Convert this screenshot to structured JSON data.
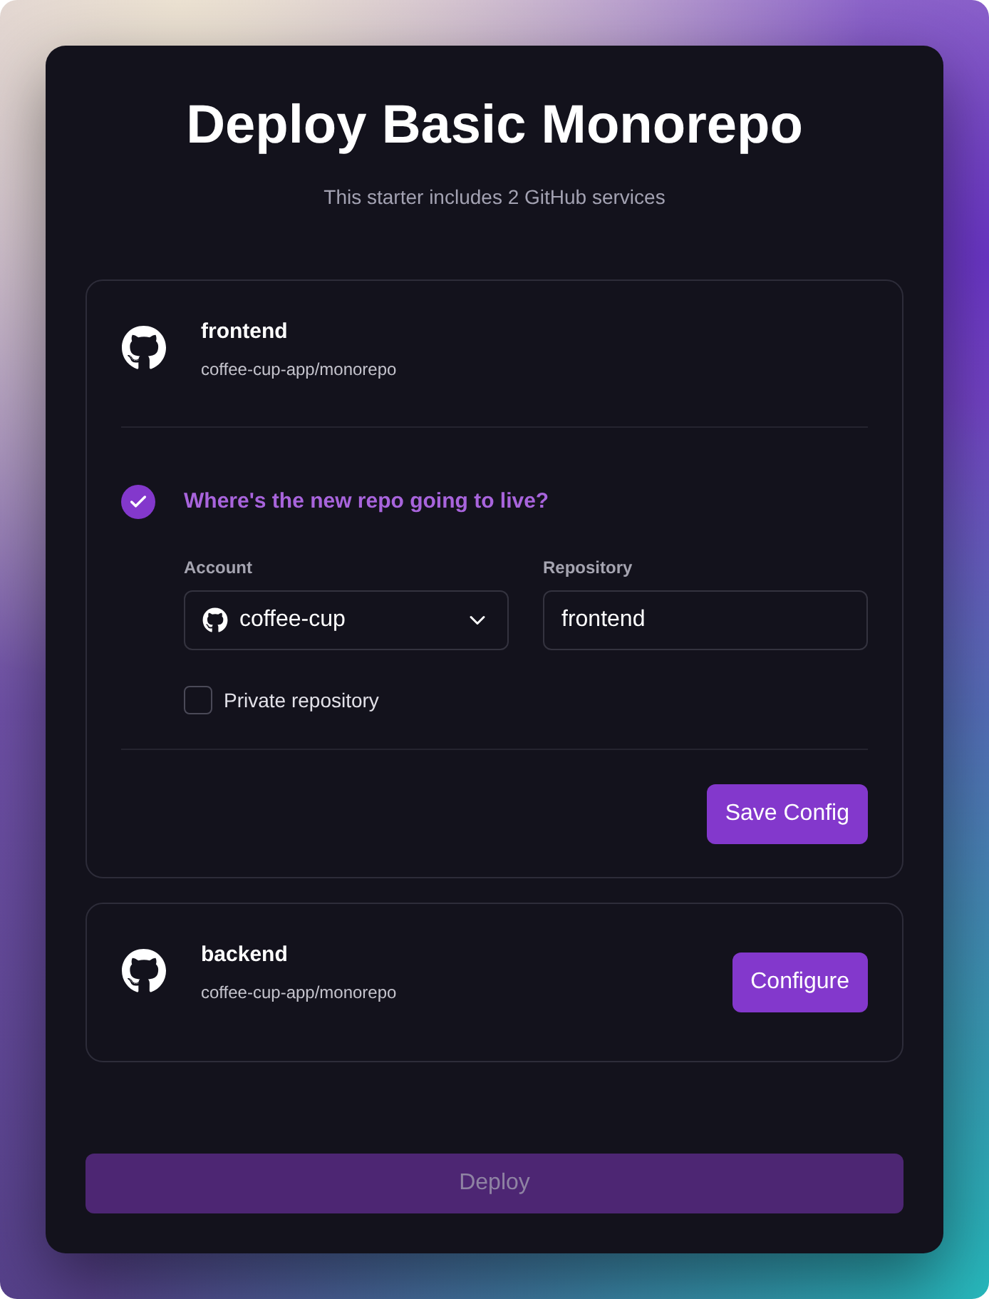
{
  "dialog": {
    "title": "Deploy Basic Monorepo",
    "subtitle": "This starter includes 2 GitHub services"
  },
  "services": [
    {
      "name": "frontend",
      "repo": "coffee-cup-app/monorepo",
      "expanded": true,
      "config": {
        "step": {
          "label": "Where's the new repo going to live?",
          "done": true
        },
        "account": {
          "label": "Account",
          "value": "coffee-cup"
        },
        "repository": {
          "label": "Repository",
          "value": "frontend"
        },
        "private": {
          "label": "Private repository",
          "checked": false
        },
        "save_button": "Save Config"
      }
    },
    {
      "name": "backend",
      "repo": "coffee-cup-app/monorepo",
      "expanded": false,
      "configure_button": "Configure"
    }
  ],
  "deploy_button": {
    "label": "Deploy",
    "disabled": true
  }
}
